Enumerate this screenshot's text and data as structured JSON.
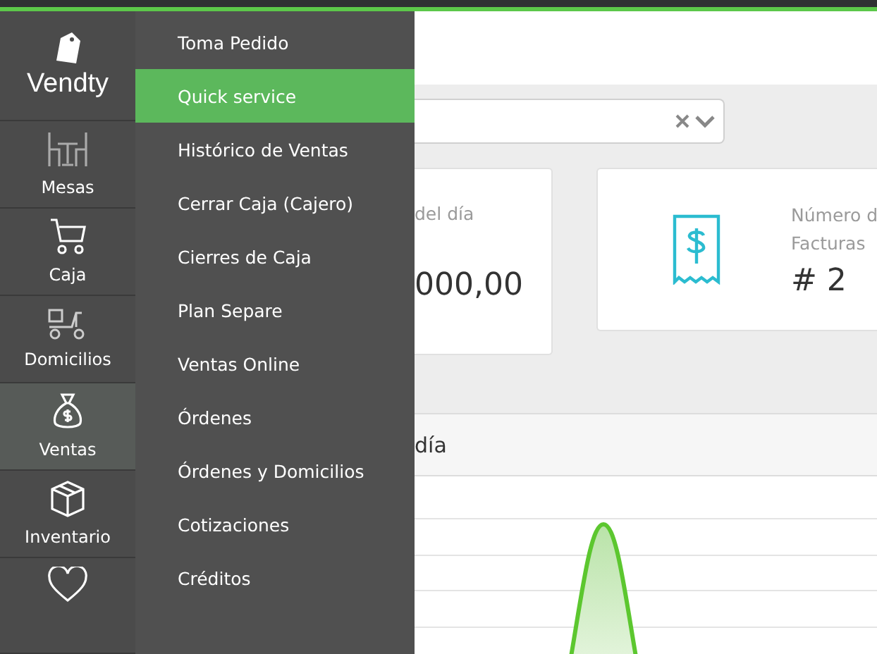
{
  "brand": "Vendty",
  "sidebar": {
    "items": [
      {
        "label": "Mesas",
        "selected": false
      },
      {
        "label": "Caja",
        "selected": false
      },
      {
        "label": "Domicilios",
        "selected": false
      },
      {
        "label": "Ventas",
        "selected": true
      },
      {
        "label": "Inventario",
        "selected": false
      }
    ]
  },
  "submenu": {
    "items": [
      {
        "label": "Toma Pedido",
        "selected": false
      },
      {
        "label": "Quick service",
        "selected": true
      },
      {
        "label": "Histórico de Ventas",
        "selected": false
      },
      {
        "label": "Cerrar Caja (Cajero)",
        "selected": false
      },
      {
        "label": "Cierres de Caja",
        "selected": false
      },
      {
        "label": "Plan Separe",
        "selected": false
      },
      {
        "label": "Ventas Online",
        "selected": false
      },
      {
        "label": "Órdenes",
        "selected": false
      },
      {
        "label": "Órdenes y Domicilios",
        "selected": false
      },
      {
        "label": "Cotizaciones",
        "selected": false
      },
      {
        "label": "Créditos",
        "selected": false
      }
    ]
  },
  "cards": [
    {
      "label": "del día",
      "value": "000,00"
    },
    {
      "label": "Número d",
      "label_2": "Facturas",
      "value": "# 2"
    }
  ],
  "chart_section": {
    "title": "día"
  }
}
